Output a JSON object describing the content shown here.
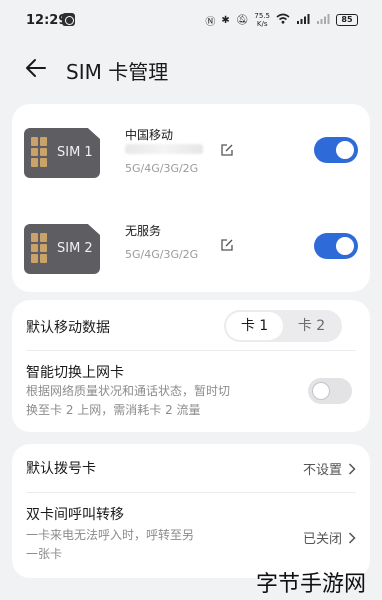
{
  "status_bar": {
    "time": "12:29",
    "net_speed_value": "75.5",
    "net_speed_unit": "K/s",
    "battery": "85"
  },
  "header": {
    "title": "SIM 卡管理"
  },
  "sims": [
    {
      "chip_label": "SIM 1",
      "carrier": "中国移动",
      "network": "5G/4G/3G/2G",
      "enabled": true
    },
    {
      "chip_label": "SIM 2",
      "carrier": "无服务",
      "network": "5G/4G/3G/2G",
      "enabled": true
    }
  ],
  "data_settings": {
    "default_data_label": "默认移动数据",
    "options": [
      "卡 1",
      "卡 2"
    ],
    "selected_option": "卡 1",
    "smart_switch_label": "智能切换上网卡",
    "smart_switch_desc_line1": "根据网络质量状况和通话状态，暂时切",
    "smart_switch_desc_line2": "换至卡 2 上网，需消耗卡 2 流量",
    "smart_switch_enabled": false
  },
  "call_settings": {
    "default_dial_label": "默认拨号卡",
    "default_dial_value": "不设置",
    "forward_label": "双卡间呼叫转移",
    "forward_desc_line1": "一卡来电无法呼入时，呼转至另",
    "forward_desc_line2": "一张卡",
    "forward_value": "已关闭"
  },
  "watermark": "字节手游网",
  "colors": {
    "accent": "#2f6bd8",
    "background": "#f1f2f4",
    "card": "#ffffff"
  }
}
